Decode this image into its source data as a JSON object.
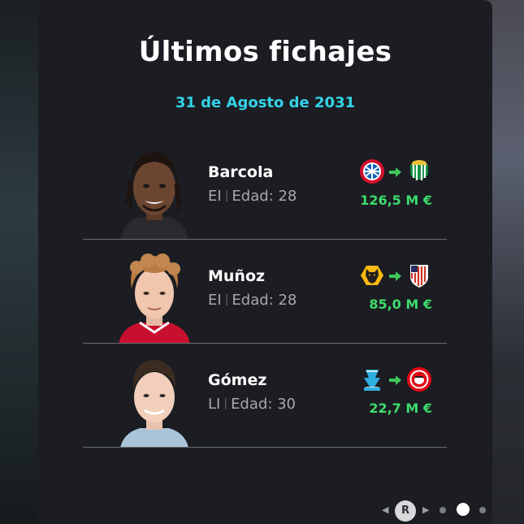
{
  "panel": {
    "title": "Últimos fichajes",
    "date": "31 de Agosto de 2031"
  },
  "transfers": [
    {
      "name": "Barcola",
      "position": "EI",
      "age_label": "Edad: 28",
      "fee": "126,5 M €",
      "from_icon": "bayern-munich-crest-icon",
      "to_icon": "real-betis-crest-icon"
    },
    {
      "name": "Muñoz",
      "position": "EI",
      "age_label": "Edad: 28",
      "fee": "85,0 M €",
      "from_icon": "wolves-crest-icon",
      "to_icon": "atletico-madrid-crest-icon"
    },
    {
      "name": "Gómez",
      "position": "LI",
      "age_label": "Edad: 30",
      "fee": "22,7 M €",
      "from_icon": "marseille-crest-icon",
      "to_icon": "brentford-crest-icon"
    }
  ],
  "pager": {
    "button_label": "R",
    "page_count": 3,
    "active_page": 2
  },
  "colors": {
    "accent_date": "#34d3e8",
    "fee_green": "#3ddc6c",
    "arrow_green": "#3cc85c",
    "card_bg": "#1b1d22"
  }
}
